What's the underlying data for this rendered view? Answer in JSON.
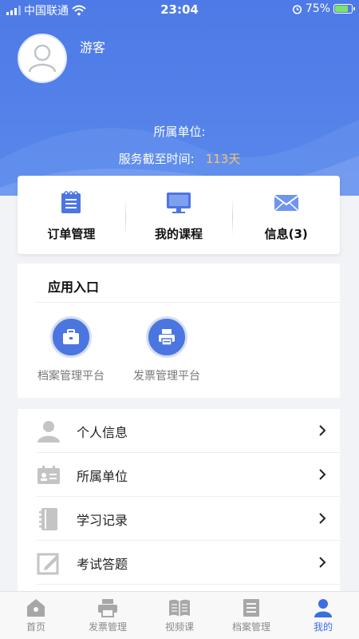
{
  "status_bar": {
    "carrier": "中国联通",
    "time": "23:04",
    "battery": "75%"
  },
  "profile": {
    "username": "游客",
    "unit_label": "所属单位:",
    "expire_label": "服务截至时间:",
    "expire_value": "113天"
  },
  "quick_actions": [
    {
      "label": "订单管理",
      "icon": "order-list-icon"
    },
    {
      "label": "我的课程",
      "icon": "monitor-icon"
    },
    {
      "label": "信息(3)",
      "icon": "mail-icon"
    }
  ],
  "apps": {
    "title": "应用入口",
    "items": [
      {
        "label": "档案管理平台",
        "icon": "briefcase-icon"
      },
      {
        "label": "发票管理平台",
        "icon": "printer-icon"
      }
    ]
  },
  "menu": [
    {
      "label": "个人信息",
      "icon": "person-icon"
    },
    {
      "label": "所属单位",
      "icon": "id-card-icon"
    },
    {
      "label": "学习记录",
      "icon": "notebook-icon"
    },
    {
      "label": "考试答题",
      "icon": "edit-icon"
    }
  ],
  "tabs": [
    {
      "label": "首页",
      "icon": "home-icon"
    },
    {
      "label": "发票管理",
      "icon": "printer-icon"
    },
    {
      "label": "视频课",
      "icon": "book-icon"
    },
    {
      "label": "档案管理",
      "icon": "document-icon"
    },
    {
      "label": "我的",
      "icon": "user-icon"
    }
  ],
  "colors": {
    "primary": "#4d7ae6",
    "accent": "#f3c56b",
    "active_tab": "#3b6fe0"
  }
}
